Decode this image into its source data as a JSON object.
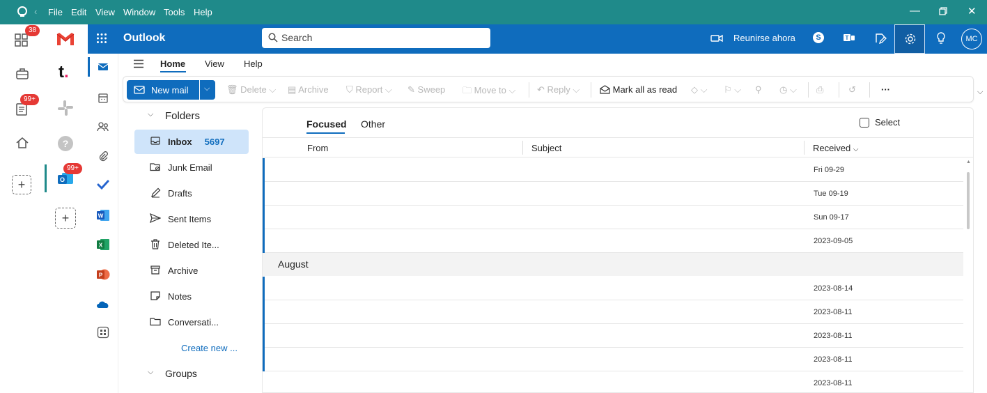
{
  "titlebar": {
    "menu": [
      "File",
      "Edit",
      "View",
      "Window",
      "Tools",
      "Help"
    ],
    "bg_color": "#1f8a8a"
  },
  "rail": {
    "badges": {
      "apps": "38",
      "docs": "99+",
      "outlook": "99+"
    }
  },
  "outlook_header": {
    "app_title": "Outlook",
    "search_placeholder": "Search",
    "meet_now": "Reunirse ahora",
    "avatar": "MC",
    "brand_color": "#0f6cbd"
  },
  "tabs": [
    "Home",
    "View",
    "Help"
  ],
  "ribbon": {
    "new_mail": "New mail",
    "delete": "Delete",
    "archive": "Archive",
    "report": "Report",
    "sweep": "Sweep",
    "move_to": "Move to",
    "reply": "Reply",
    "mark_all_read": "Mark all as read",
    "more": "···"
  },
  "folders": {
    "header": "Folders",
    "items": [
      {
        "label": "Inbox",
        "count": "5697",
        "icon": "inbox-icon"
      },
      {
        "label": "Junk Email",
        "icon": "junk-icon"
      },
      {
        "label": "Drafts",
        "icon": "drafts-icon"
      },
      {
        "label": "Sent Items",
        "icon": "send-icon"
      },
      {
        "label": "Deleted Ite...",
        "icon": "trash-icon"
      },
      {
        "label": "Archive",
        "icon": "archive-icon"
      },
      {
        "label": "Notes",
        "icon": "note-icon"
      },
      {
        "label": "Conversati...",
        "icon": "folder-icon"
      }
    ],
    "create_new": "Create new ...",
    "groups": "Groups"
  },
  "mail_list": {
    "tab_focused": "Focused",
    "tab_other": "Other",
    "select": "Select",
    "col_from": "From",
    "col_subject": "Subject",
    "col_received": "Received",
    "group_label": "August",
    "rows_top": [
      "Fri 09-29",
      "Tue 09-19",
      "Sun 09-17",
      "2023-09-05"
    ],
    "rows_august": [
      "2023-08-14",
      "2023-08-11",
      "2023-08-11",
      "2023-08-11",
      "2023-08-11"
    ]
  }
}
